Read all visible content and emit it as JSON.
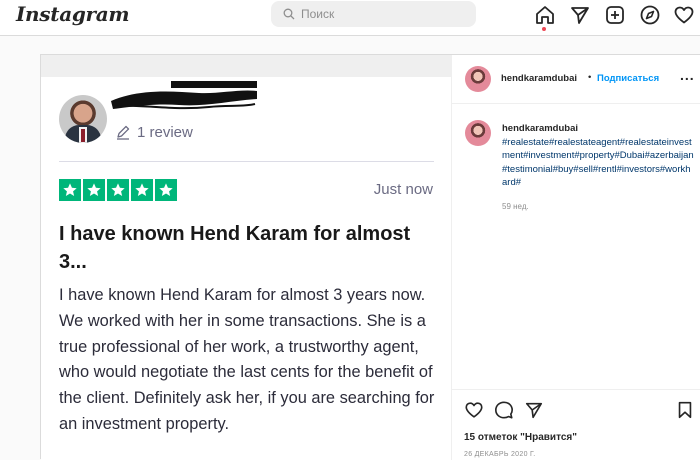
{
  "header": {
    "logo": "Instagram",
    "search_placeholder": "Поиск"
  },
  "nav": {
    "icons": [
      "home-icon",
      "direct-icon",
      "new-post-icon",
      "explore-icon",
      "activity-icon"
    ]
  },
  "review": {
    "count_label": "1 review",
    "rating_stars": 5,
    "time": "Just now",
    "title": "I have known Hend Karam for almost 3...",
    "body": "I have known Hend Karam for almost 3 years now. We worked with her in some transactions. She is a true professional of her work, a trustworthy agent, who would negotiate the last cents for the benefit of the client. Definitely ask her, if you are searching for an investment property.",
    "star_color": "#00b67a"
  },
  "post": {
    "username": "hendkaramdubai",
    "separator": "•",
    "follow_label": "Подписаться",
    "more_label": "...",
    "caption_user": "hendkaramdubai",
    "caption": "#realestate#realestateagent#realestateinvestment#investment#property#Dubai#azerbaijan#testimonial#buy#sell#rentl#investors#workhard#",
    "caption_time": "59 нед.",
    "likes": "15 отметок \"Нравится\"",
    "date": "26 ДЕКАБРЬ 2020 Г.",
    "link_color": "#00376b",
    "follow_color": "#0095f6"
  }
}
